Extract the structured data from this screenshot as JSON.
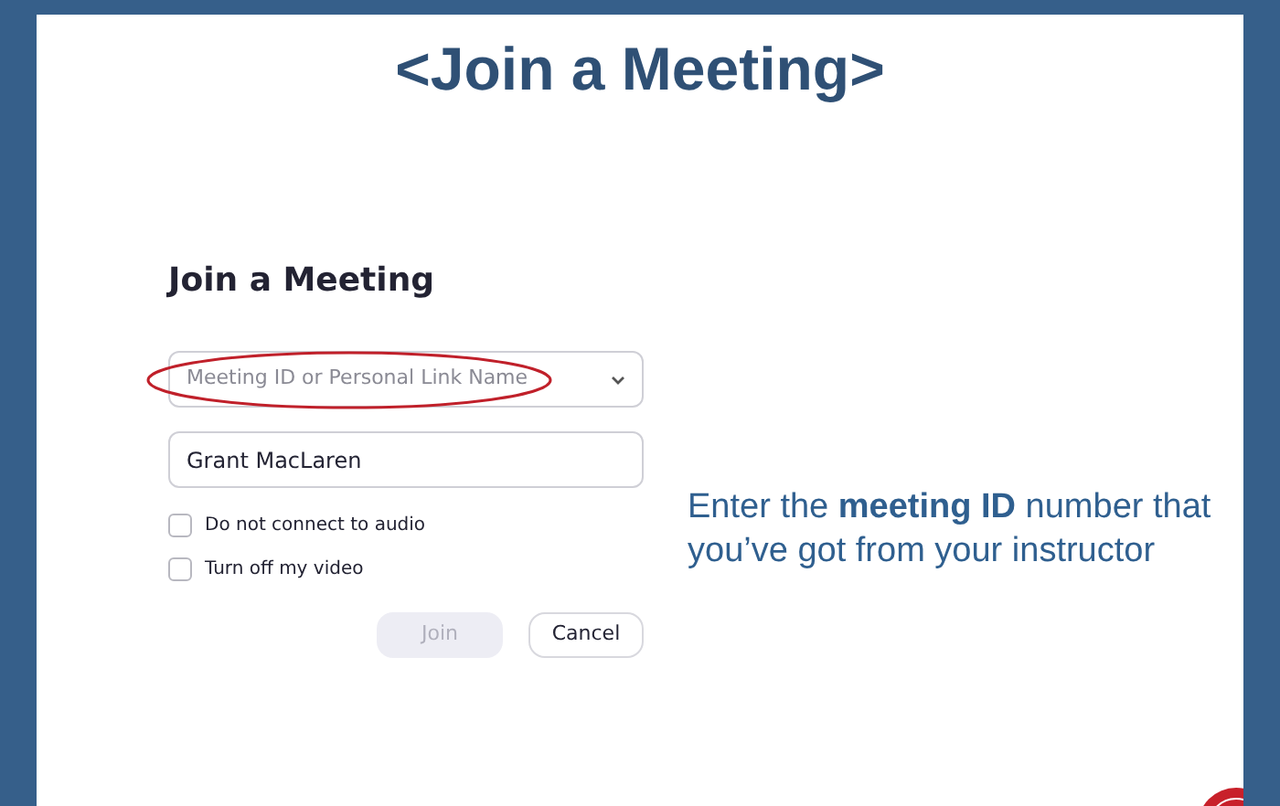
{
  "slide": {
    "title": "<Join a Meeting>",
    "instruction": "Enter the **meeting ID** number that you’ve got from your instructor"
  },
  "dialog": {
    "heading": "Join a Meeting",
    "meeting_field": {
      "placeholder": "Meeting ID or Personal Link Name",
      "highlighted": true
    },
    "name_field": {
      "value": "Grant MacLaren"
    },
    "options": [
      {
        "label": "Do not connect to audio",
        "checked": false
      },
      {
        "label": "Turn off my video",
        "checked": false
      }
    ],
    "buttons": [
      {
        "label": "Join",
        "kind": "primary",
        "disabled": true
      },
      {
        "label": "Cancel",
        "kind": "secondary",
        "disabled": false
      }
    ]
  }
}
